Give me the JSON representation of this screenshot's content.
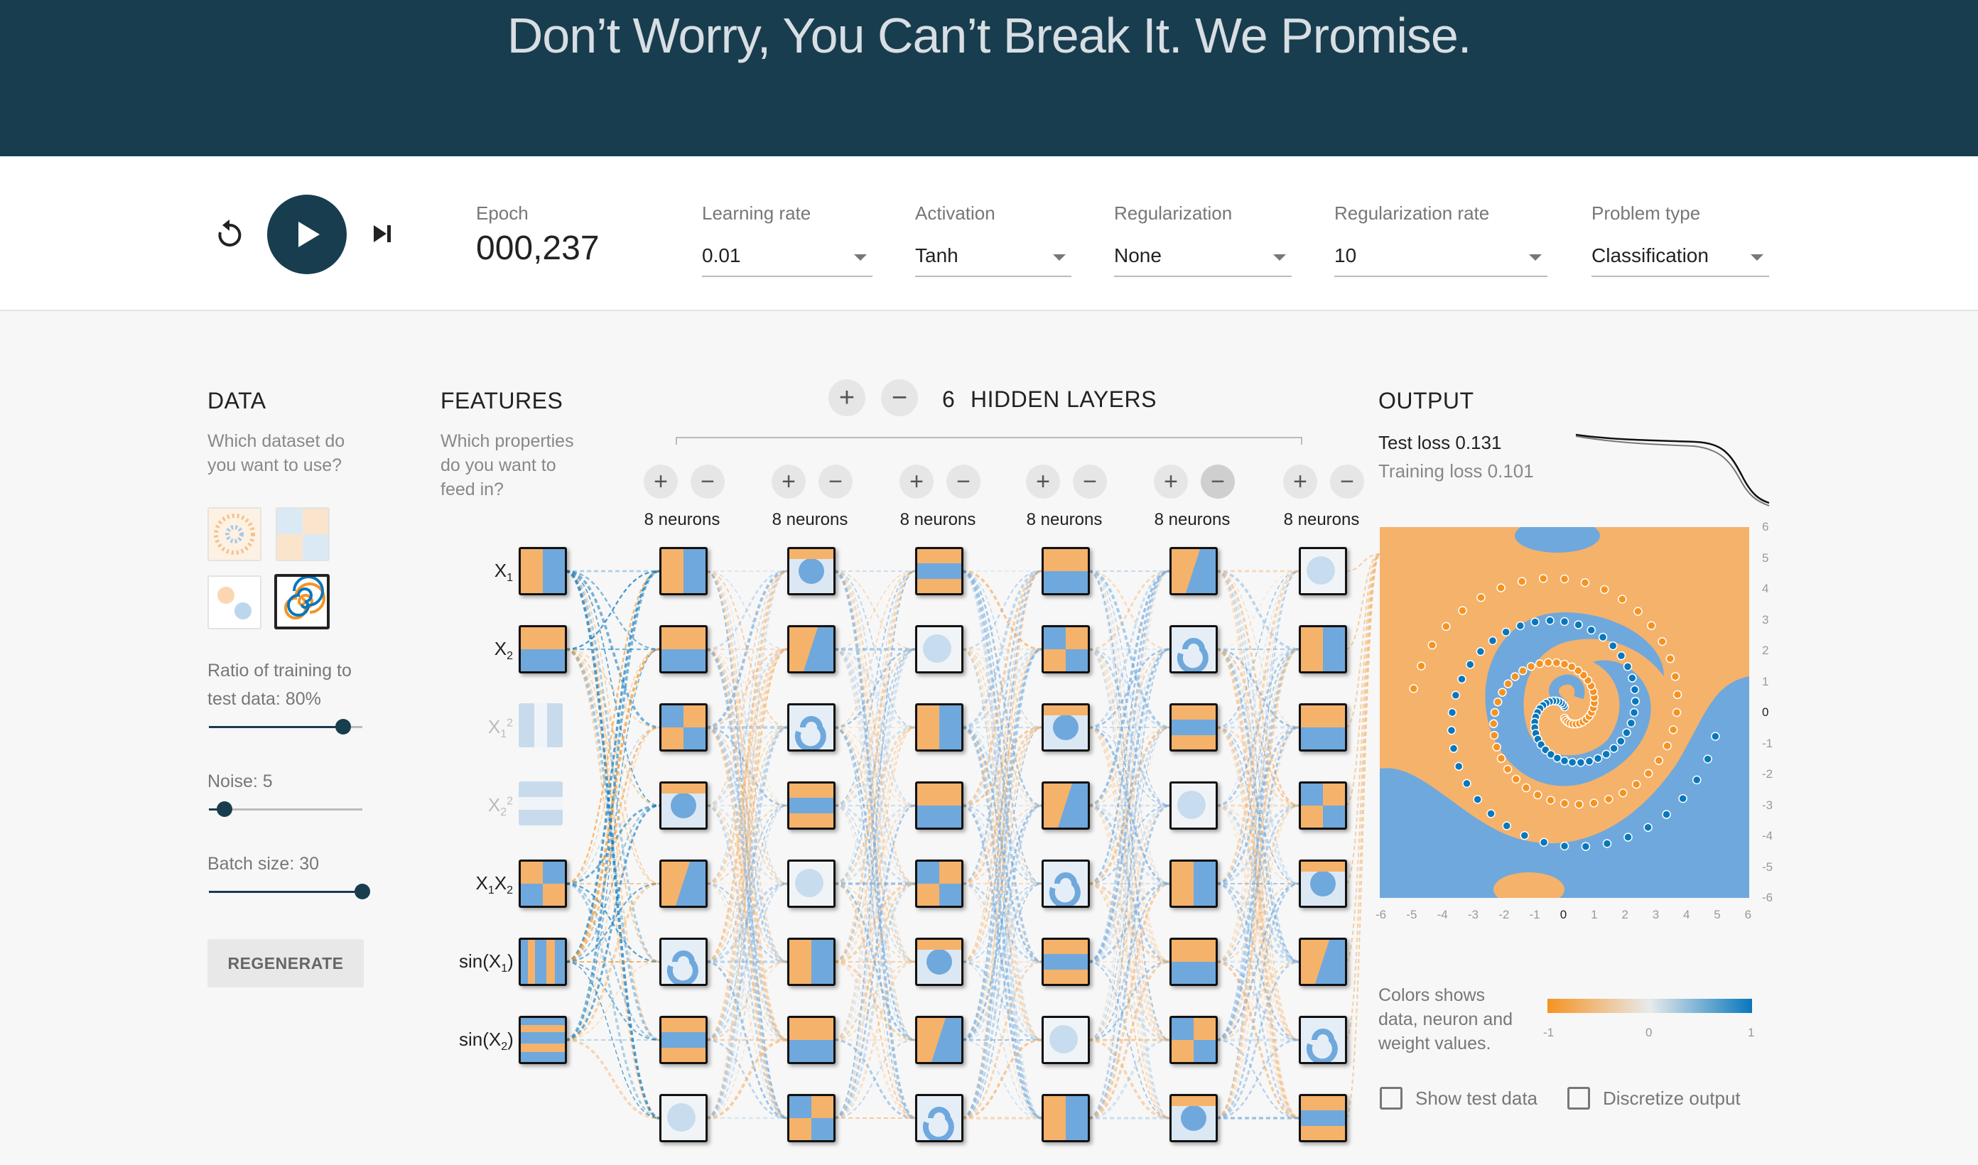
{
  "header": {
    "title": "Don’t Worry, You Can’t Break It. We Promise."
  },
  "controls": {
    "epoch": {
      "label": "Epoch",
      "value": "000,237"
    },
    "learning_rate": {
      "label": "Learning rate",
      "value": "0.01"
    },
    "activation": {
      "label": "Activation",
      "value": "Tanh"
    },
    "regularization": {
      "label": "Regularization",
      "value": "None"
    },
    "regularization_rate": {
      "label": "Regularization rate",
      "value": "10"
    },
    "problem_type": {
      "label": "Problem type",
      "value": "Classification"
    },
    "icons": {
      "reset": "reset-icon",
      "play": "play-icon",
      "step": "step-forward-icon"
    }
  },
  "data_panel": {
    "title": "DATA",
    "subtitle_1": "Which dataset do",
    "subtitle_2": "you want to use?",
    "datasets": [
      "circle",
      "xor",
      "gaussian",
      "spiral"
    ],
    "selected_dataset": "spiral",
    "ratio_label": "Ratio of training to",
    "ratio_label_2": "test data:  80%",
    "ratio_value": 80,
    "noise_label": "Noise:  5",
    "noise_value": 5,
    "batch_label": "Batch size:  30",
    "batch_value": 30,
    "regenerate": "REGENERATE"
  },
  "features_panel": {
    "title": "FEATURES",
    "subtitle_1": "Which properties",
    "subtitle_2": "do you want to",
    "subtitle_3": "feed in?",
    "features": [
      {
        "base": "X",
        "sub": "1",
        "sup": "",
        "after": "",
        "active": true
      },
      {
        "base": "X",
        "sub": "2",
        "sup": "",
        "after": "",
        "active": true
      },
      {
        "base": "X",
        "sub": "1",
        "sup": "2",
        "after": "",
        "active": false
      },
      {
        "base": "X",
        "sub": "2",
        "sup": "2",
        "after": "",
        "active": false
      },
      {
        "base": "X",
        "sub": "1",
        "sup": "",
        "after": "X2",
        "active": true
      },
      {
        "base": "sin(X",
        "sub": "1",
        "sup": "",
        "after": ")",
        "active": true
      },
      {
        "base": "sin(X",
        "sub": "2",
        "sup": "",
        "after": ")",
        "active": true
      }
    ]
  },
  "network": {
    "hidden_layers_count": "6",
    "hidden_layers_label": "HIDDEN LAYERS",
    "layers": [
      {
        "neurons": "8 neurons"
      },
      {
        "neurons": "8 neurons"
      },
      {
        "neurons": "8 neurons"
      },
      {
        "neurons": "8 neurons"
      },
      {
        "neurons": "8 neurons"
      },
      {
        "neurons": "8 neurons"
      }
    ],
    "add_symbol": "+",
    "remove_symbol": "−"
  },
  "output_panel": {
    "title": "OUTPUT",
    "test_loss": "Test loss 0.131",
    "training_loss": "Training loss 0.101",
    "y_ticks": [
      "6",
      "5",
      "4",
      "3",
      "2",
      "1",
      "0",
      "-1",
      "-2",
      "-3",
      "-4",
      "-5",
      "-6"
    ],
    "x_ticks": [
      "-6",
      "-5",
      "-4",
      "-3",
      "-2",
      "-1",
      "0",
      "1",
      "2",
      "3",
      "4",
      "5",
      "6"
    ],
    "legend_1": "Colors shows",
    "legend_2": "data, neuron and",
    "legend_3": "weight values.",
    "scale_min": "-1",
    "scale_mid": "0",
    "scale_max": "1",
    "show_test_data": "Show test data",
    "discretize_output": "Discretize output"
  },
  "colors": {
    "header_bg": "#183d4e",
    "orange": "#f59322",
    "blue": "#0877bd",
    "light_orange": "#f5b26b",
    "light_blue": "#6fa8dc"
  }
}
